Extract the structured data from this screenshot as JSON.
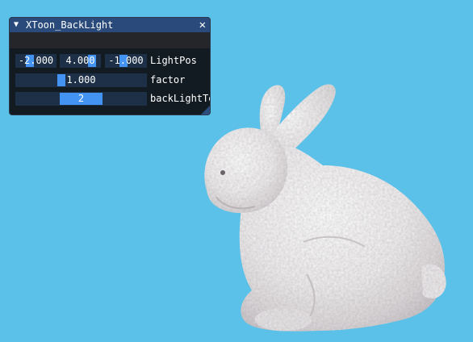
{
  "colors": {
    "background": "#5bc1e8",
    "titlebar": "#294a7a",
    "frame": "#1d3048",
    "grab": "#4293f2"
  },
  "scene": {
    "object_icon": "bunny-model"
  },
  "window": {
    "title": "XToon_BackLight",
    "collapse_icon": "collapse-arrow-icon",
    "collapse_glyph": "▼",
    "close_icon": "close-icon",
    "close_glyph": "✕"
  },
  "controls": {
    "lightpos": {
      "label": "LightPos",
      "values": [
        "-2.000",
        "4.000",
        "-1.000"
      ]
    },
    "factor": {
      "label": "factor",
      "value": "1.000"
    },
    "backlight": {
      "label": "backLightTe",
      "value": "2"
    }
  }
}
